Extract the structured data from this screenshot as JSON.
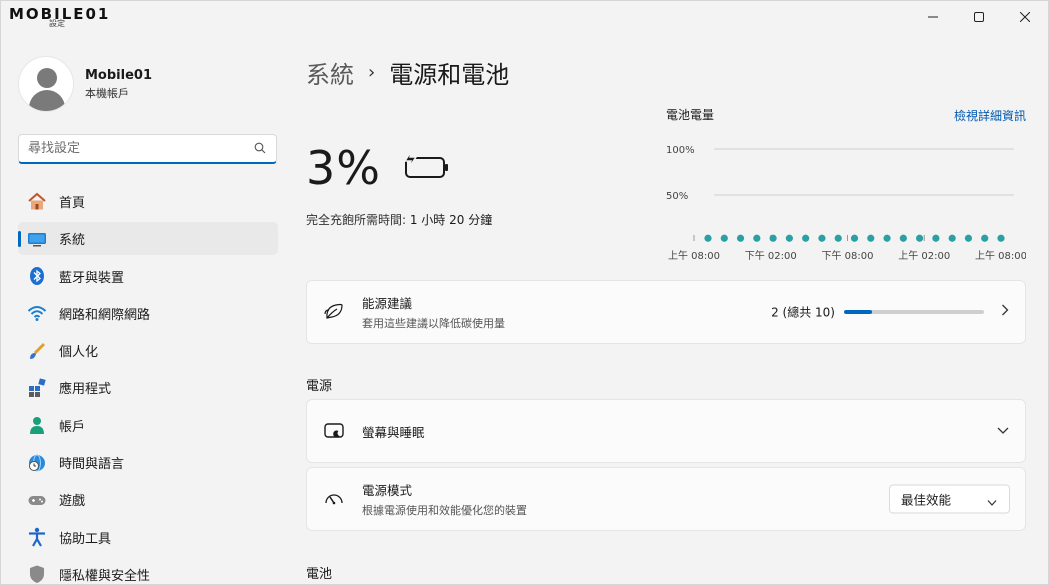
{
  "watermark": {
    "brand": "MOBILE01",
    "sub": "設定"
  },
  "window_controls": {
    "minimize": "—",
    "maximize": "☐",
    "close": "✕"
  },
  "profile": {
    "name": "Mobile01",
    "account_type": "本機帳戶"
  },
  "search": {
    "placeholder": "尋找設定"
  },
  "sidebar": {
    "items": [
      {
        "label": "首頁",
        "icon": "home-icon"
      },
      {
        "label": "系統",
        "icon": "system-icon",
        "active": true
      },
      {
        "label": "藍牙與裝置",
        "icon": "bluetooth-icon"
      },
      {
        "label": "網路和網際網路",
        "icon": "wifi-icon"
      },
      {
        "label": "個人化",
        "icon": "brush-icon"
      },
      {
        "label": "應用程式",
        "icon": "apps-icon"
      },
      {
        "label": "帳戶",
        "icon": "accounts-icon"
      },
      {
        "label": "時間與語言",
        "icon": "globe-clock-icon"
      },
      {
        "label": "遊戲",
        "icon": "gamepad-icon"
      },
      {
        "label": "協助工具",
        "icon": "accessibility-icon"
      },
      {
        "label": "隱私權與安全性",
        "icon": "shield-icon"
      }
    ]
  },
  "breadcrumb": {
    "parent": "系統",
    "separator": "›",
    "current": "電源和電池"
  },
  "battery": {
    "percent": "3%",
    "charge_time_label": "完全充飽所需時間: ",
    "charge_time_value": "1 小時 20 分鐘"
  },
  "chart_header": {
    "title": "電池電量",
    "link": "檢視詳細資訊"
  },
  "chart_data": {
    "type": "line",
    "title": "電池電量",
    "y_tick_labels": [
      "100%",
      "50%"
    ],
    "x_tick_labels": [
      "上午 08:00",
      "下午 02:00",
      "下午 08:00",
      "上午 02:00",
      "上午 08:00"
    ],
    "ylim": [
      0,
      100
    ],
    "series": [
      {
        "values": [
          3,
          3,
          3,
          3,
          3,
          3,
          3,
          3,
          3,
          3,
          3,
          3,
          3,
          3,
          3,
          3,
          3,
          3,
          3
        ]
      }
    ],
    "series_color": "#2aa0a4"
  },
  "recommendations": {
    "title": "能源建議",
    "subtitle": "套用這些建議以降低碳使用量",
    "count": "2 (總共 10)",
    "progress": 0.2
  },
  "power_section": {
    "heading": "電源"
  },
  "screen_sleep": {
    "title": "螢幕與睡眠"
  },
  "power_mode": {
    "title": "電源模式",
    "subtitle": "根據電源使用和效能優化您的裝置",
    "selected": "最佳效能"
  },
  "battery_section": {
    "heading": "電池"
  },
  "colors": {
    "accent": "#0067c0",
    "chart_dot": "#2aa0a4",
    "link": "#0058b0"
  }
}
